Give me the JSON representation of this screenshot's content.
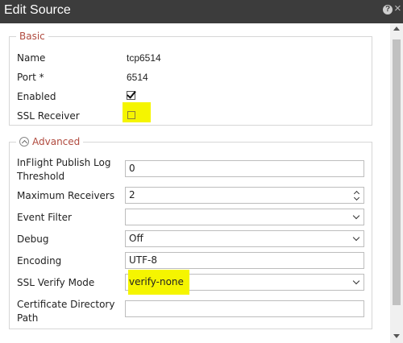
{
  "window": {
    "title": "Edit Source",
    "help_icon": "?",
    "close_icon": "×"
  },
  "basic": {
    "legend": "Basic",
    "name_label": "Name",
    "name_value": "tcp6514",
    "port_label": "Port *",
    "port_value": "6514",
    "enabled_label": "Enabled",
    "enabled_checked": true,
    "ssl_receiver_label": "SSL Receiver",
    "ssl_receiver_checked": false
  },
  "advanced": {
    "legend": "Advanced",
    "inflight_label_line1": "InFlight Publish Log",
    "inflight_label_line2": "Threshold",
    "inflight_value": "0",
    "max_receivers_label": "Maximum Receivers",
    "max_receivers_value": "2",
    "event_filter_label": "Event Filter",
    "event_filter_value": "",
    "debug_label": "Debug",
    "debug_value": "Off",
    "encoding_label": "Encoding",
    "encoding_value": "UTF-8",
    "ssl_verify_label": "SSL Verify Mode",
    "ssl_verify_value": "verify-none",
    "cert_dir_label_line1": "Certificate Directory",
    "cert_dir_label_line2": "Path",
    "cert_dir_value": ""
  },
  "colors": {
    "titlebar": "#3c3c3c",
    "legend_text": "#b04a3e",
    "highlight": "#f5f500"
  }
}
